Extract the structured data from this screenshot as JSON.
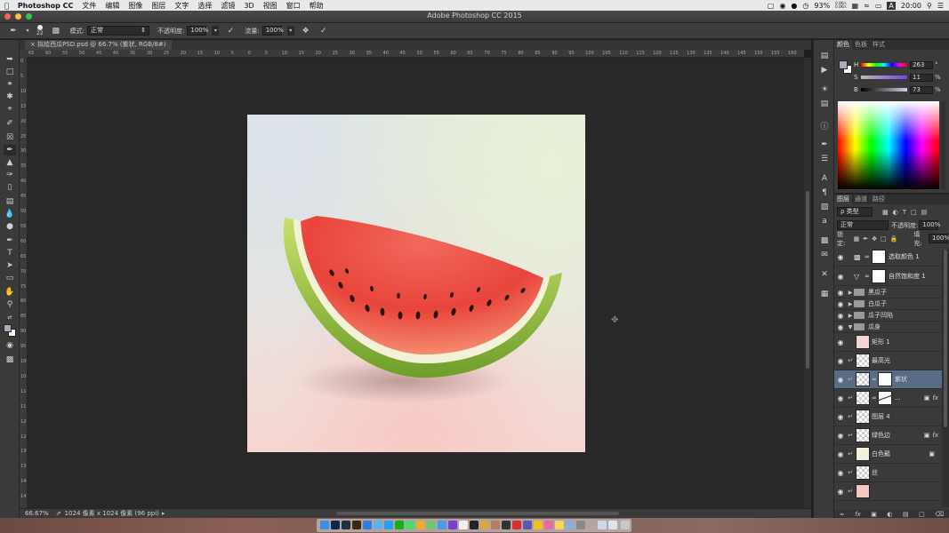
{
  "menubar": {
    "app": "Photoshop CC",
    "items": [
      "文件",
      "编辑",
      "图像",
      "图层",
      "文字",
      "选择",
      "滤镜",
      "3D",
      "视图",
      "窗口",
      "帮助"
    ],
    "status": {
      "battery": "93%",
      "time": "20:00",
      "user_initial": "A",
      "net_up": "0.0K/s",
      "net_down": "0.0K/s"
    }
  },
  "window": {
    "title": "Adobe Photoshop CC 2015"
  },
  "options": {
    "brush_size": "22",
    "mode_label": "模式:",
    "mode_value": "正常",
    "opacity_label": "不透明度:",
    "opacity_value": "100%",
    "flow_label": "流量:",
    "flow_value": "100%"
  },
  "document": {
    "tab_label": "拟绘西瓜PSD.psd @ 66.7% (紫状, RGB/8#)"
  },
  "rulers": {
    "h": [
      "65",
      "60",
      "55",
      "50",
      "45",
      "40",
      "35",
      "30",
      "25",
      "20",
      "15",
      "10",
      "5",
      "0",
      "5",
      "10",
      "15",
      "20",
      "25",
      "30",
      "35",
      "40",
      "45",
      "50",
      "55",
      "60",
      "65",
      "70",
      "75",
      "80",
      "85",
      "90",
      "95",
      "100",
      "105",
      "110",
      "115",
      "120",
      "125",
      "130",
      "135",
      "140",
      "145",
      "150",
      "155",
      "160"
    ],
    "v": [
      "0",
      "5",
      "10",
      "15",
      "20",
      "25",
      "30",
      "35",
      "40",
      "45",
      "50",
      "55",
      "60",
      "65",
      "70",
      "75",
      "80",
      "85",
      "90",
      "95",
      "100",
      "105",
      "110",
      "115",
      "120",
      "125",
      "130",
      "135",
      "140",
      "145"
    ]
  },
  "status": {
    "zoom": "66.67%",
    "doc_info": "1024 像素 x 1024 像素 (96 ppi)"
  },
  "color_panel": {
    "tabs": [
      "颜色",
      "色板",
      "样式"
    ],
    "h": {
      "label": "H",
      "value": "263",
      "unit": "°"
    },
    "s": {
      "label": "S",
      "value": "11",
      "unit": "%"
    },
    "b": {
      "label": "B",
      "value": "73",
      "unit": "%"
    }
  },
  "layers_panel": {
    "tabs": [
      "图层",
      "通道",
      "路径"
    ],
    "filter_label": "ρ 类型",
    "blend_mode": "正常",
    "opacity_label": "不透明度:",
    "opacity_value": "100%",
    "lock_label": "锁定:",
    "fill_label": "填充:",
    "fill_value": "100%",
    "layers": [
      {
        "name": "选取颜色 1",
        "kind": "adjustment"
      },
      {
        "name": "自然饱和度 1",
        "kind": "adjustment"
      },
      {
        "name": "黑瓜子",
        "kind": "group"
      },
      {
        "name": "白瓜子",
        "kind": "group"
      },
      {
        "name": "瓜子凹陷",
        "kind": "group"
      },
      {
        "name": "瓜身",
        "kind": "group-open"
      },
      {
        "name": "矩形 1",
        "kind": "layer"
      },
      {
        "name": "最高光",
        "kind": "layer"
      },
      {
        "name": "紫状",
        "kind": "layer-selected"
      },
      {
        "name": "...",
        "kind": "layer-fx"
      },
      {
        "name": "图层 4",
        "kind": "layer"
      },
      {
        "name": "绿色边",
        "kind": "layer-fx"
      },
      {
        "name": "白色瓤",
        "kind": "layer"
      },
      {
        "name": "丝",
        "kind": "layer"
      },
      {
        "name": "",
        "kind": "layer"
      }
    ],
    "fx_label": "fx"
  },
  "colors": {
    "accent": "#5a6b85",
    "panel": "#3a3a3a",
    "watermelon_red": "#e8453b",
    "rind_green": "#8fbf3a"
  }
}
